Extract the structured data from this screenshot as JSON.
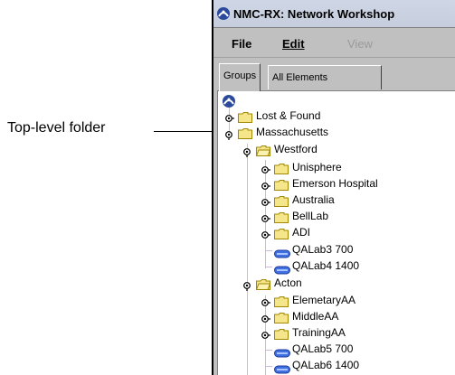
{
  "callout": {
    "label": "Top-level folder"
  },
  "window": {
    "title": "NMC-RX: Network Workshop",
    "menus": [
      "File",
      "Edit",
      "View"
    ],
    "tabs": [
      "Groups",
      "All Elements"
    ]
  },
  "tree": {
    "items": [
      {
        "label": "Lost & Found",
        "type": "folder",
        "expander": "collapsed"
      },
      {
        "label": "Massachusetts",
        "type": "folder",
        "expander": "expanded"
      },
      {
        "label": "Westford",
        "type": "folder-open",
        "expander": "expanded"
      },
      {
        "label": "Unisphere",
        "type": "folder",
        "expander": "collapsed"
      },
      {
        "label": "Emerson Hospital",
        "type": "folder",
        "expander": "collapsed"
      },
      {
        "label": "Australia",
        "type": "folder",
        "expander": "collapsed"
      },
      {
        "label": "BellLab",
        "type": "folder",
        "expander": "collapsed"
      },
      {
        "label": "ADI",
        "type": "folder",
        "expander": "collapsed"
      },
      {
        "label": "QALab3 700",
        "type": "device",
        "expander": "none"
      },
      {
        "label": "QALab4 1400",
        "type": "device",
        "expander": "none"
      },
      {
        "label": "Acton",
        "type": "folder-open",
        "expander": "expanded"
      },
      {
        "label": "ElemetaryAA",
        "type": "folder",
        "expander": "collapsed"
      },
      {
        "label": "MiddleAA",
        "type": "folder",
        "expander": "collapsed"
      },
      {
        "label": "TrainingAA",
        "type": "folder",
        "expander": "collapsed"
      },
      {
        "label": "QALab5 700",
        "type": "device",
        "expander": "none"
      },
      {
        "label": "QALab6 1400",
        "type": "device",
        "expander": "none"
      }
    ]
  },
  "colors": {
    "folder": "#f5e68c",
    "folder_border": "#a08800",
    "device": "#3f6fe0",
    "tree_line": "#d0b8d8"
  }
}
